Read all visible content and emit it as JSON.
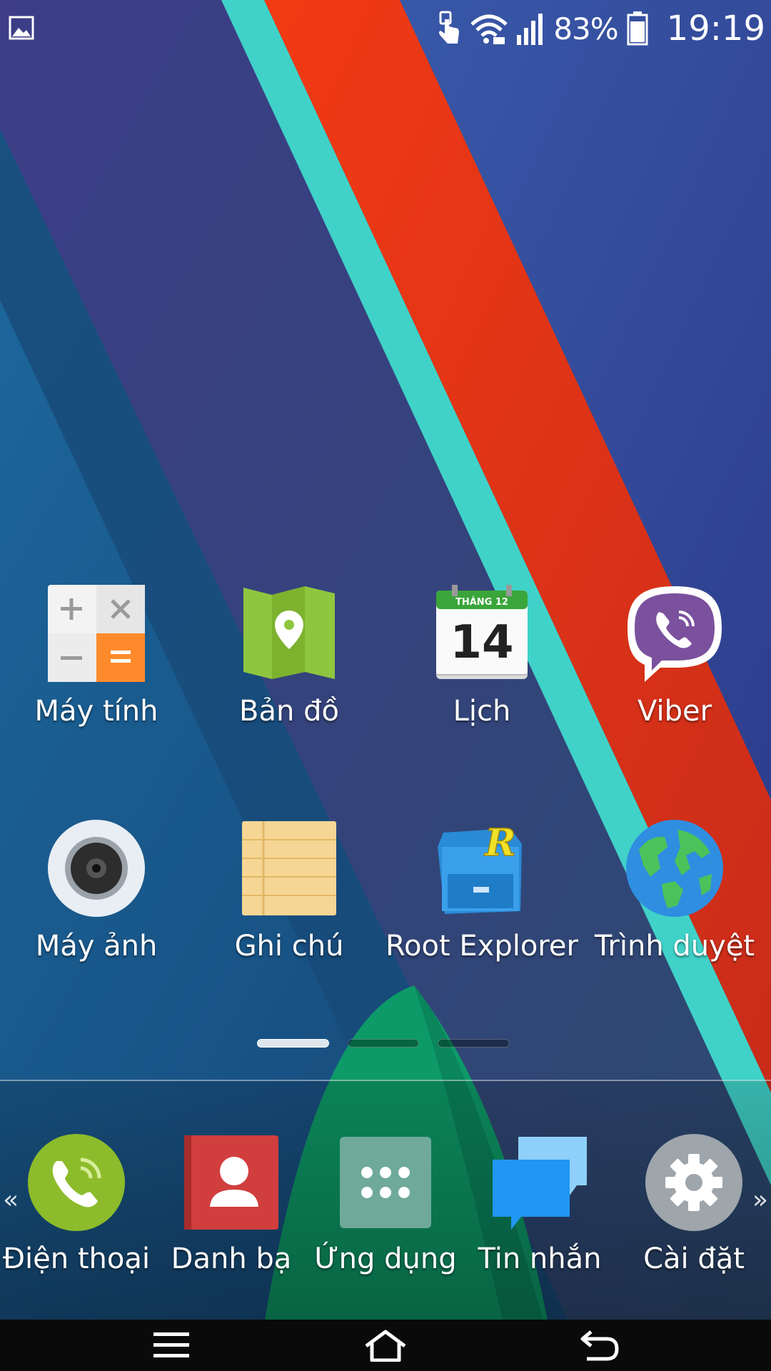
{
  "status_bar": {
    "battery_percent": "83%",
    "time": "19:19"
  },
  "home_apps": [
    {
      "label": "Máy tính"
    },
    {
      "label": "Bản đồ"
    },
    {
      "label": "Lịch",
      "calendar_month": "THÁNG 12",
      "calendar_day": "14"
    },
    {
      "label": "Viber"
    },
    {
      "label": "Máy ảnh"
    },
    {
      "label": "Ghi chú"
    },
    {
      "label": "Root Explorer"
    },
    {
      "label": "Trình duyệt"
    }
  ],
  "dock_apps": [
    {
      "label": "Điện thoại"
    },
    {
      "label": "Danh bạ"
    },
    {
      "label": "Ứng dụng"
    },
    {
      "label": "Tin nhắn"
    },
    {
      "label": "Cài đặt"
    }
  ],
  "dock": {
    "left_arrow": "«",
    "right_arrow": "»"
  },
  "page_indicator": {
    "count": 3,
    "active": 0
  },
  "colors": {
    "wall_blue": "#1b4f7c",
    "wall_orange": "#e0381b",
    "wall_teal": "#40d2c8",
    "wall_green": "#0d9a68",
    "viber": "#7b519d",
    "phone_green": "#8cbc2b",
    "contacts_red": "#d13e3e",
    "apps_teal": "#6fa99a",
    "messages_blue": "#2196f3",
    "settings_gray": "#9ea5ab"
  },
  "icons": [
    "gallery-icon",
    "touch-icon",
    "wifi-icon",
    "signal-icon",
    "battery-icon",
    "menu-icon",
    "home-icon",
    "back-icon"
  ]
}
